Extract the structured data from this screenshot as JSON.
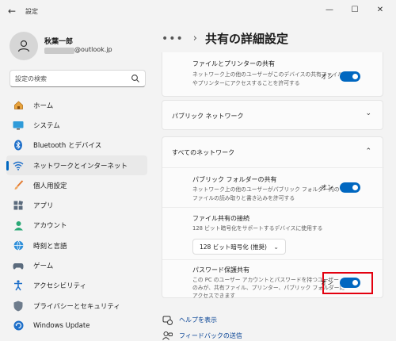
{
  "window": {
    "title": "設定",
    "back_glyph": "←",
    "minimize_glyph": "—",
    "maximize_glyph": "☐",
    "close_glyph": "✕"
  },
  "profile": {
    "name": "秋葉一郎",
    "email": "@outlook.jp"
  },
  "search": {
    "placeholder": "設定の検索"
  },
  "sidebar": {
    "items": [
      {
        "label": "ホーム",
        "icon": "home-icon"
      },
      {
        "label": "システム",
        "icon": "system-icon"
      },
      {
        "label": "Bluetooth とデバイス",
        "icon": "bluetooth-icon"
      },
      {
        "label": "ネットワークとインターネット",
        "icon": "network-icon",
        "active": true
      },
      {
        "label": "個人用設定",
        "icon": "brush-icon"
      },
      {
        "label": "アプリ",
        "icon": "apps-icon"
      },
      {
        "label": "アカウント",
        "icon": "account-icon"
      },
      {
        "label": "時刻と言語",
        "icon": "time-language-icon"
      },
      {
        "label": "ゲーム",
        "icon": "gaming-icon"
      },
      {
        "label": "アクセシビリティ",
        "icon": "accessibility-icon"
      },
      {
        "label": "プライバシーとセキュリティ",
        "icon": "shield-icon"
      },
      {
        "label": "Windows Update",
        "icon": "windows-update-icon"
      }
    ]
  },
  "breadcrumb": {
    "dots": "•••",
    "chevron": "›",
    "title": "共有の詳細設定"
  },
  "sections": {
    "private": {
      "file_printer_title": "ファイルとプリンターの共有",
      "file_printer_desc_1": "ネットワーク上の他のユーザーがこのデバイスの共有ファイル",
      "file_printer_desc_2": "やプリンターにアクセスすることを許可する",
      "file_printer_state": "オン"
    },
    "public": {
      "header": "パブリック ネットワーク",
      "chevron": "⌄"
    },
    "all": {
      "header": "すべてのネットワーク",
      "chevron": "⌃",
      "public_folder_title": "パブリック フォルダーの共有",
      "public_folder_desc_1": "ネットワーク上の他のユーザーがパブリック フォルダー内の",
      "public_folder_desc_2": "ファイルの読み取りと書き込みを許可する",
      "public_folder_state": "オン",
      "file_sharing_title": "ファイル共有の接続",
      "file_sharing_desc": "128 ビット暗号化をサポートするデバイスに使用する",
      "encryption_value": "128 ビット暗号化 (推奨)",
      "encryption_chevron": "⌄",
      "password_title": "パスワード保護共有",
      "password_desc_1": "この PC のユーザー アカウントとパスワードを持つユーザー",
      "password_desc_2": "のみが、共有ファイル、プリンター、パブリック フォルダーに",
      "password_desc_3": "アクセスできます",
      "password_state": "オン"
    }
  },
  "footer": {
    "help": "ヘルプを表示",
    "feedback": "フィードバックの送信"
  },
  "colors": {
    "accent": "#0067c0",
    "highlight": "#e3000f",
    "link": "#003e92"
  }
}
